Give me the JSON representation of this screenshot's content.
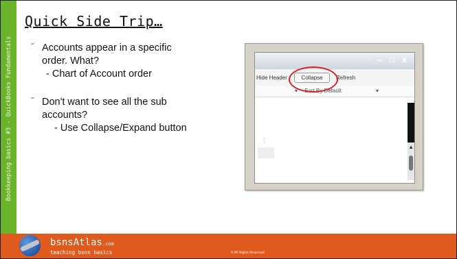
{
  "sidebar": {
    "text": "Bookkeeping basics #3 - QuickBooks Fundamentals"
  },
  "title": "Quick Side Trip…",
  "bullets": [
    {
      "marker": "˝",
      "text": "Accounts appear in a specific order.  What?",
      "sub": "- Chart of Account order"
    },
    {
      "marker": "˝",
      "text": "Don't want to see all the sub accounts?",
      "sub": "- Use Collapse/Expand button"
    }
  ],
  "screenshot": {
    "window_controls": {
      "minimize": "–",
      "maximize": "□",
      "close": "x"
    },
    "toolbar": {
      "hide_header": "Hide Header",
      "collapse": "Collapse",
      "refresh": "Refresh"
    },
    "sort_by": "Sort By  Default",
    "highlight_color": "#d91f1f"
  },
  "footer": {
    "brand": "bsnsAtlas",
    "brand_suffix": ".com",
    "tagline": "teaching bsns basics",
    "copyright": "© All Rights Reserved"
  },
  "colors": {
    "sidebar": "#6bb32a",
    "footer": "#e05a1e"
  }
}
